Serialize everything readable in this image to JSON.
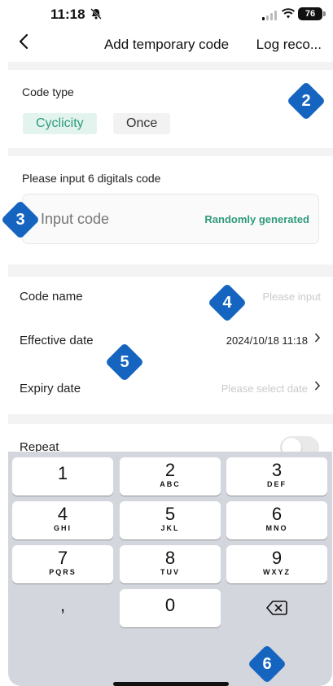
{
  "status_bar": {
    "time": "11:18",
    "battery": "76"
  },
  "nav": {
    "title": "Add temporary code",
    "right_label": "Log reco..."
  },
  "code_type": {
    "label": "Code type",
    "options": [
      "Cyclicity",
      "Once"
    ],
    "selected": "Cyclicity"
  },
  "code_input": {
    "label": "Please input 6 digitals code",
    "placeholder": "Input code",
    "random_label": "Randomly generated"
  },
  "form": {
    "code_name": {
      "label": "Code name",
      "placeholder": "Please input"
    },
    "effective_date": {
      "label": "Effective date",
      "value": "2024/10/18 11:18"
    },
    "expiry_date": {
      "label": "Expiry date",
      "placeholder": "Please select date"
    },
    "repeat": {
      "label": "Repeat",
      "enabled": false
    }
  },
  "badges": [
    "2",
    "3",
    "4",
    "5",
    "6"
  ],
  "keyboard": {
    "keys": [
      {
        "digit": "1",
        "letters": ""
      },
      {
        "digit": "2",
        "letters": "ABC"
      },
      {
        "digit": "3",
        "letters": "DEF"
      },
      {
        "digit": "4",
        "letters": "GHI"
      },
      {
        "digit": "5",
        "letters": "JKL"
      },
      {
        "digit": "6",
        "letters": "MNO"
      },
      {
        "digit": "7",
        "letters": "PQRS"
      },
      {
        "digit": "8",
        "letters": "TUV"
      },
      {
        "digit": "9",
        "letters": "WXYZ"
      },
      {
        "digit": ",",
        "letters": ""
      },
      {
        "digit": "0",
        "letters": ""
      }
    ]
  },
  "colors": {
    "accent": "#2d9a7c",
    "badge": "#1565c0",
    "chip_active_bg": "#e3f4ef",
    "keyboard_bg": "#d3d6dc"
  },
  "icons": {
    "back": "chevron-left-icon",
    "chevron": "chevron-right-icon",
    "delete": "backspace-icon",
    "silent": "bell-slash-icon"
  }
}
